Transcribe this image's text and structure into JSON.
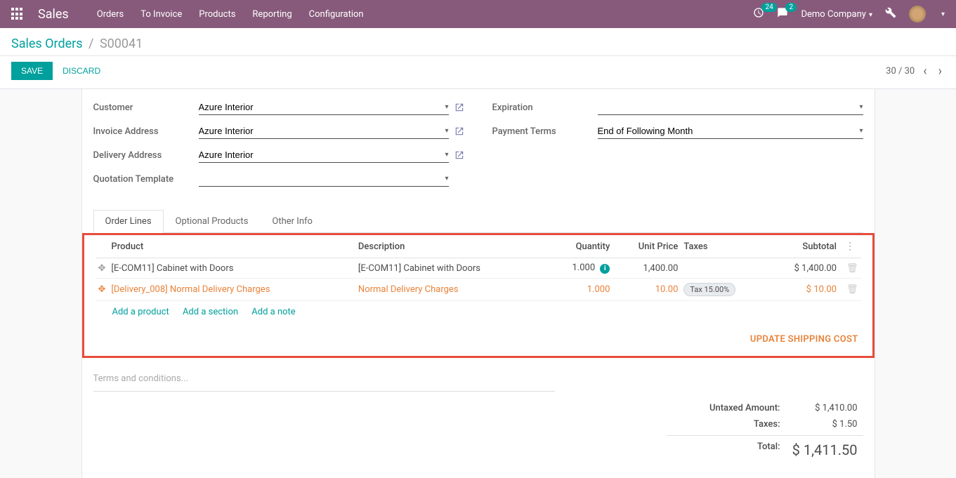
{
  "brand": "Sales",
  "nav": {
    "orders": "Orders",
    "to_invoice": "To Invoice",
    "products": "Products",
    "reporting": "Reporting",
    "configuration": "Configuration"
  },
  "topbar": {
    "clock_badge": "24",
    "chat_badge": "2",
    "company": "Demo Company"
  },
  "breadcrumb": {
    "parent": "Sales Orders",
    "current": "S00041"
  },
  "actions": {
    "save": "Save",
    "discard": "Discard"
  },
  "pager": {
    "position": "30 / 30"
  },
  "form": {
    "customer_label": "Customer",
    "customer": "Azure Interior",
    "invoice_label": "Invoice Address",
    "invoice": "Azure Interior",
    "delivery_label": "Delivery Address",
    "delivery": "Azure Interior",
    "quote_tmpl_label": "Quotation Template",
    "quote_tmpl": "",
    "expiration_label": "Expiration",
    "expiration": "",
    "terms_label": "Payment Terms",
    "terms": "End of Following Month"
  },
  "tabs": {
    "order_lines": "Order Lines",
    "optional": "Optional Products",
    "other": "Other Info"
  },
  "table": {
    "headers": {
      "product": "Product",
      "description": "Description",
      "quantity": "Quantity",
      "unit_price": "Unit Price",
      "taxes": "Taxes",
      "subtotal": "Subtotal"
    },
    "rows": [
      {
        "product": "[E-COM11] Cabinet with Doors",
        "description": "[E-COM11] Cabinet with Doors",
        "quantity": "1.000",
        "info": true,
        "unit_price": "1,400.00",
        "tax": "",
        "subtotal": "$ 1,400.00"
      },
      {
        "product": "[Delivery_008] Normal Delivery Charges",
        "description": "Normal Delivery Charges",
        "quantity": "1.000",
        "info": false,
        "unit_price": "10.00",
        "tax": "Tax 15.00%",
        "subtotal": "$ 10.00"
      }
    ]
  },
  "add_links": {
    "product": "Add a product",
    "section": "Add a section",
    "note": "Add a note"
  },
  "update_shipping": "UPDATE SHIPPING COST",
  "terms_placeholder": "Terms and conditions...",
  "totals": {
    "untaxed_label": "Untaxed Amount:",
    "untaxed": "$ 1,410.00",
    "taxes_label": "Taxes:",
    "taxes": "$ 1.50",
    "total_label": "Total:",
    "total": "$ 1,411.50"
  }
}
